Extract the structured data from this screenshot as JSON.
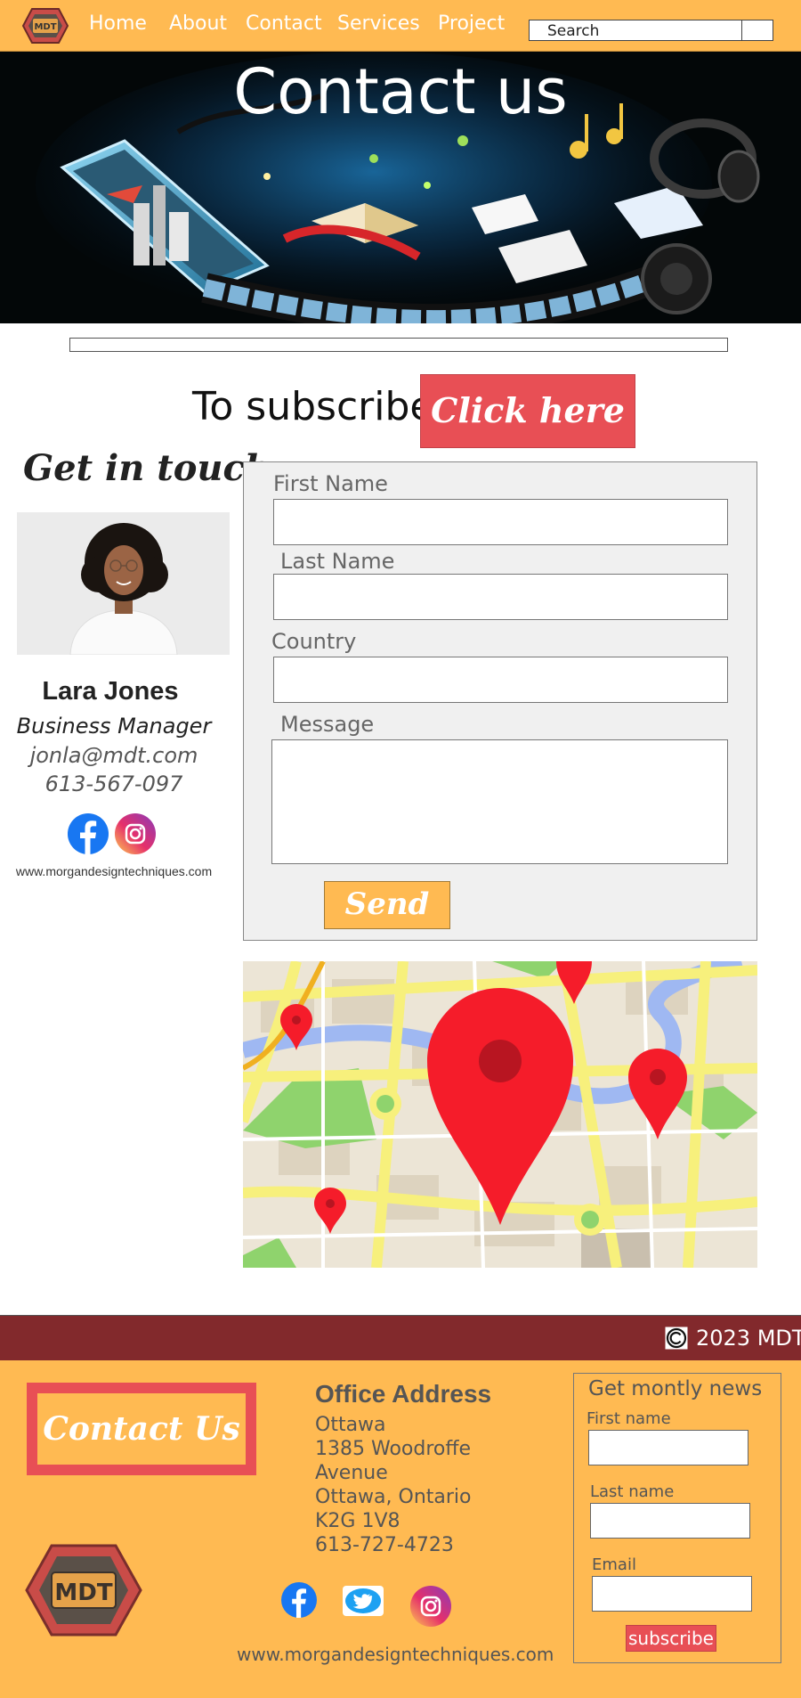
{
  "nav": {
    "links": [
      "Home",
      "About",
      "Contact",
      "Services",
      "Project"
    ],
    "search_placeholder": "Search",
    "logo_text": "MDT"
  },
  "hero": {
    "title": "Contact us"
  },
  "subscribe": {
    "text": "To subscribe",
    "button": "Click here !"
  },
  "contact_card": {
    "heading": "Get in touch",
    "name": "Lara Jones",
    "role": "Business Manager",
    "email": "jonla@mdt.com",
    "phone": "613-567-097",
    "website": "www.morgandesigntechniques.com"
  },
  "form": {
    "first_name_label": "First Name",
    "last_name_label": "Last Name",
    "country_label": "Country",
    "message_label": "Message",
    "send_button": "Send"
  },
  "footer": {
    "copyright": "2023 MDT",
    "contact_button": "Contact Us",
    "logo_text": "MDT",
    "office_title": "Office Address",
    "office_lines": [
      "Ottawa",
      "1385 Woodroffe",
      "Avenue",
      "Ottawa, Ontario",
      "K2G 1V8",
      "613-727-4723"
    ],
    "website": "www.morgandesigntechniques.com",
    "newsletter": {
      "title": "Get montly news",
      "first_name_label": "First name",
      "last_name_label": "Last name",
      "email_label": "Email",
      "button": "subscribe"
    }
  },
  "colors": {
    "nav_bg": "#ffba52",
    "accent_red": "#e84f55",
    "footer_bar": "#82292c",
    "form_bg": "#f0f0f0"
  },
  "icons": [
    "logo-icon",
    "facebook-icon",
    "instagram-icon",
    "twitter-icon",
    "copyright-icon",
    "map-pin-icon"
  ]
}
